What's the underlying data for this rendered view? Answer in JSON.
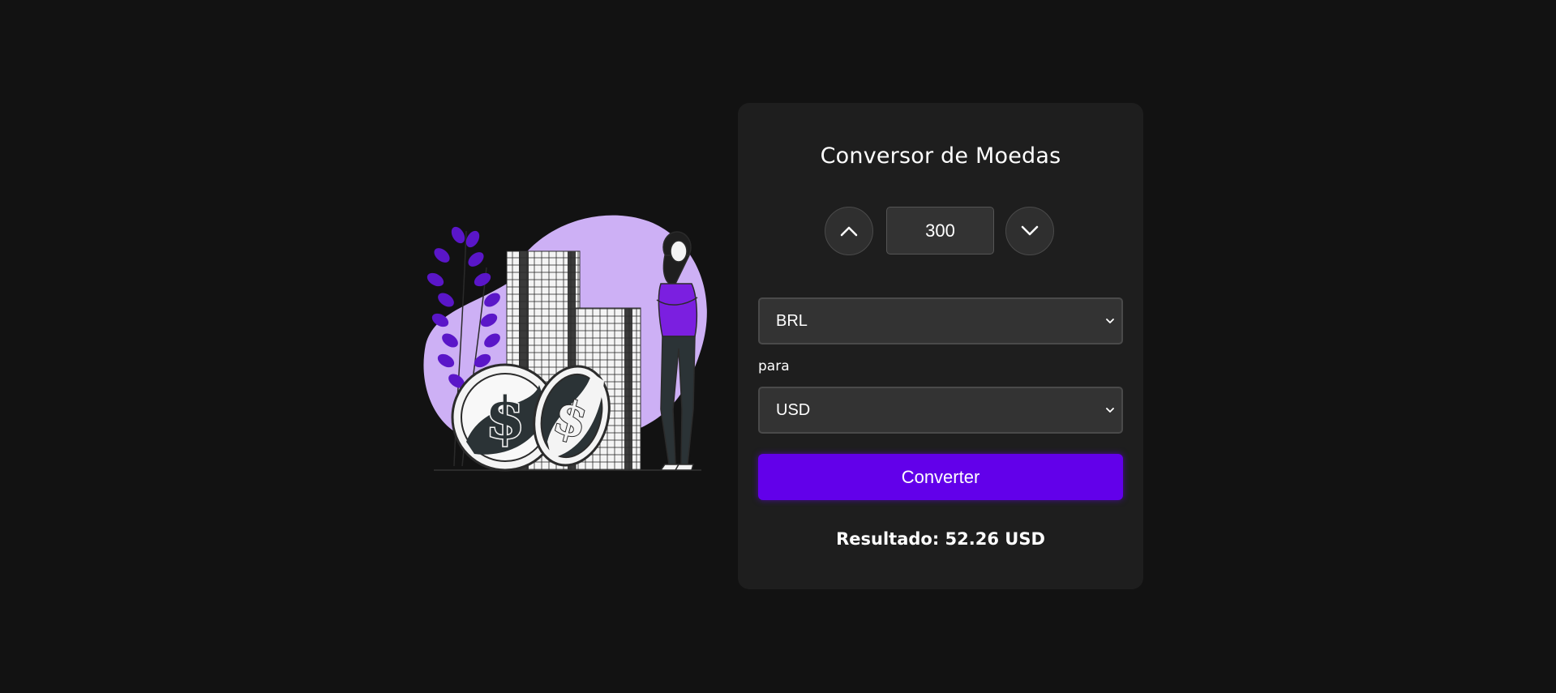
{
  "converter": {
    "title": "Conversor de Moedas",
    "amount": "300",
    "from_currency": "BRL",
    "separator_label": "para",
    "to_currency": "USD",
    "convert_label": "Converter",
    "result_text": "Resultado: 52.26 USD"
  },
  "icons": {
    "increment": "chevron-up-icon",
    "decrement": "chevron-down-icon",
    "select_arrow": "chevron-down-icon"
  },
  "colors": {
    "background": "#121212",
    "card": "#1e1e1e",
    "accent": "#6200ea",
    "illustration_blob": "#cdb0f5",
    "plant": "#5a16c8"
  }
}
